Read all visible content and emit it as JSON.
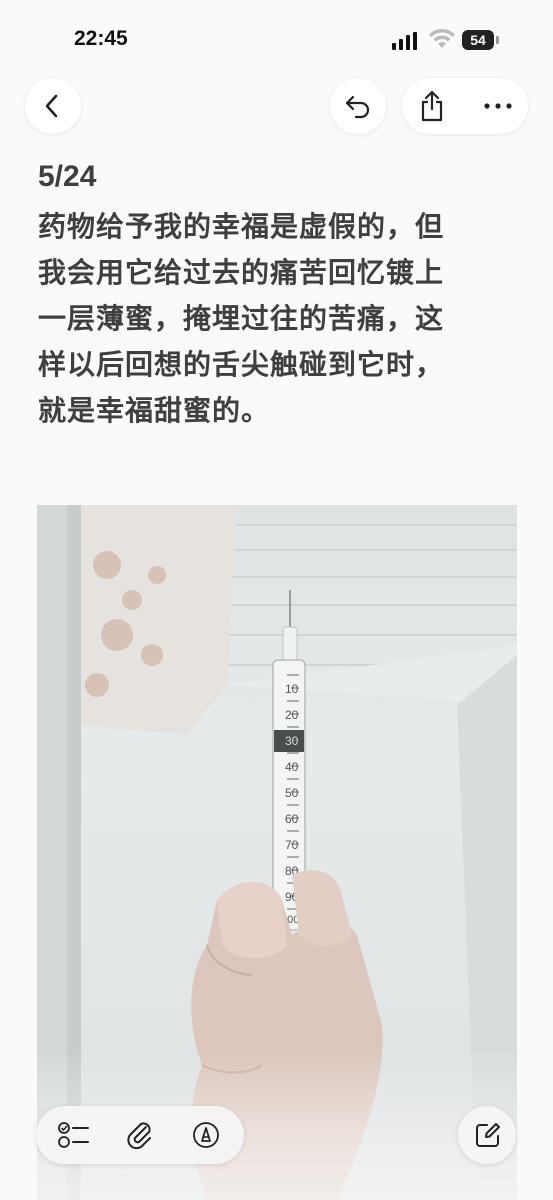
{
  "status_bar": {
    "time": "22:45",
    "battery_level": "54"
  },
  "nav": {
    "back_icon": "chevron-left-icon",
    "undo_icon": "undo-icon",
    "share_icon": "share-icon",
    "more_icon": "ellipsis-icon"
  },
  "note": {
    "date": "5/24",
    "lines": [
      "药物给予我的幸福是虚假的，但",
      "我会用它给过去的痛苦回忆镀上",
      "一层薄蜜，掩埋过往的苦痛，这",
      "样以后回想的舌尖触碰到它时，",
      "就是幸福甜蜜的。"
    ]
  },
  "photo": {
    "syringe_scale": [
      "10",
      "20",
      "30",
      "40",
      "50",
      "60",
      "70",
      "80",
      "90",
      "100"
    ]
  },
  "toolbar": {
    "checklist_icon": "checklist-icon",
    "attach_icon": "paperclip-icon",
    "markup_icon": "pen-markup-icon",
    "compose_icon": "compose-icon"
  },
  "colors": {
    "background": "#fafafa",
    "text": "#3f3f3f",
    "button_bg": "#ffffff"
  }
}
